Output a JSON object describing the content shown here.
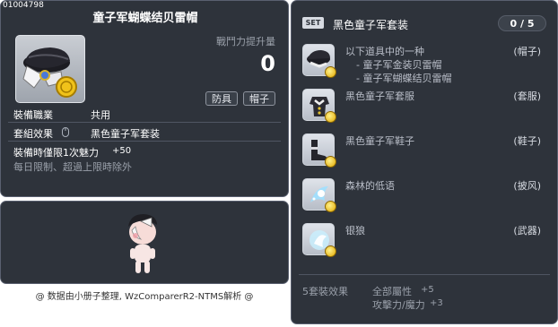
{
  "item": {
    "id": "01004798",
    "title": "童子军蝴蝶结贝雷帽",
    "power_label": "戰鬥力提升量",
    "power_value": "0",
    "tags": [
      "防具",
      "帽子"
    ],
    "job_label": "裝備職業",
    "job_value": "共用",
    "set_label": "套組效果",
    "set_value": "黑色童子军套装",
    "bonus_label": "裝備時僅限1次魅力",
    "bonus_value": "+50",
    "limit_text": "每日限制、超過上限時除外"
  },
  "footer": {
    "credit": "@ 数据由小册子整理, WzComparerR2-NTMS解析 @"
  },
  "set_panel": {
    "badge": "SET",
    "name": "黑色童子军套装",
    "count": "0 / 5",
    "pieces": [
      {
        "name": "以下道具中的一种",
        "type": "(帽子)",
        "subs": [
          "- 童子军金装贝雷帽",
          "- 童子军蝴蝶结贝雷帽"
        ],
        "icon": "hat-icon"
      },
      {
        "name": "黑色童子军套服",
        "type": "(套服)",
        "subs": [],
        "icon": "outfit-icon"
      },
      {
        "name": "黑色童子军鞋子",
        "type": "(鞋子)",
        "subs": [],
        "icon": "shoes-icon"
      },
      {
        "name": "森林的低语",
        "type": "(披风)",
        "subs": [],
        "icon": "cape-icon"
      },
      {
        "name": "银狼",
        "type": "(武器)",
        "subs": [],
        "icon": "weapon-icon"
      }
    ],
    "effect_label": "5套裝效果",
    "effects": [
      {
        "stat": "全部屬性",
        "value": "+5"
      },
      {
        "stat": "攻擊力/魔力",
        "value": "+3"
      }
    ]
  }
}
